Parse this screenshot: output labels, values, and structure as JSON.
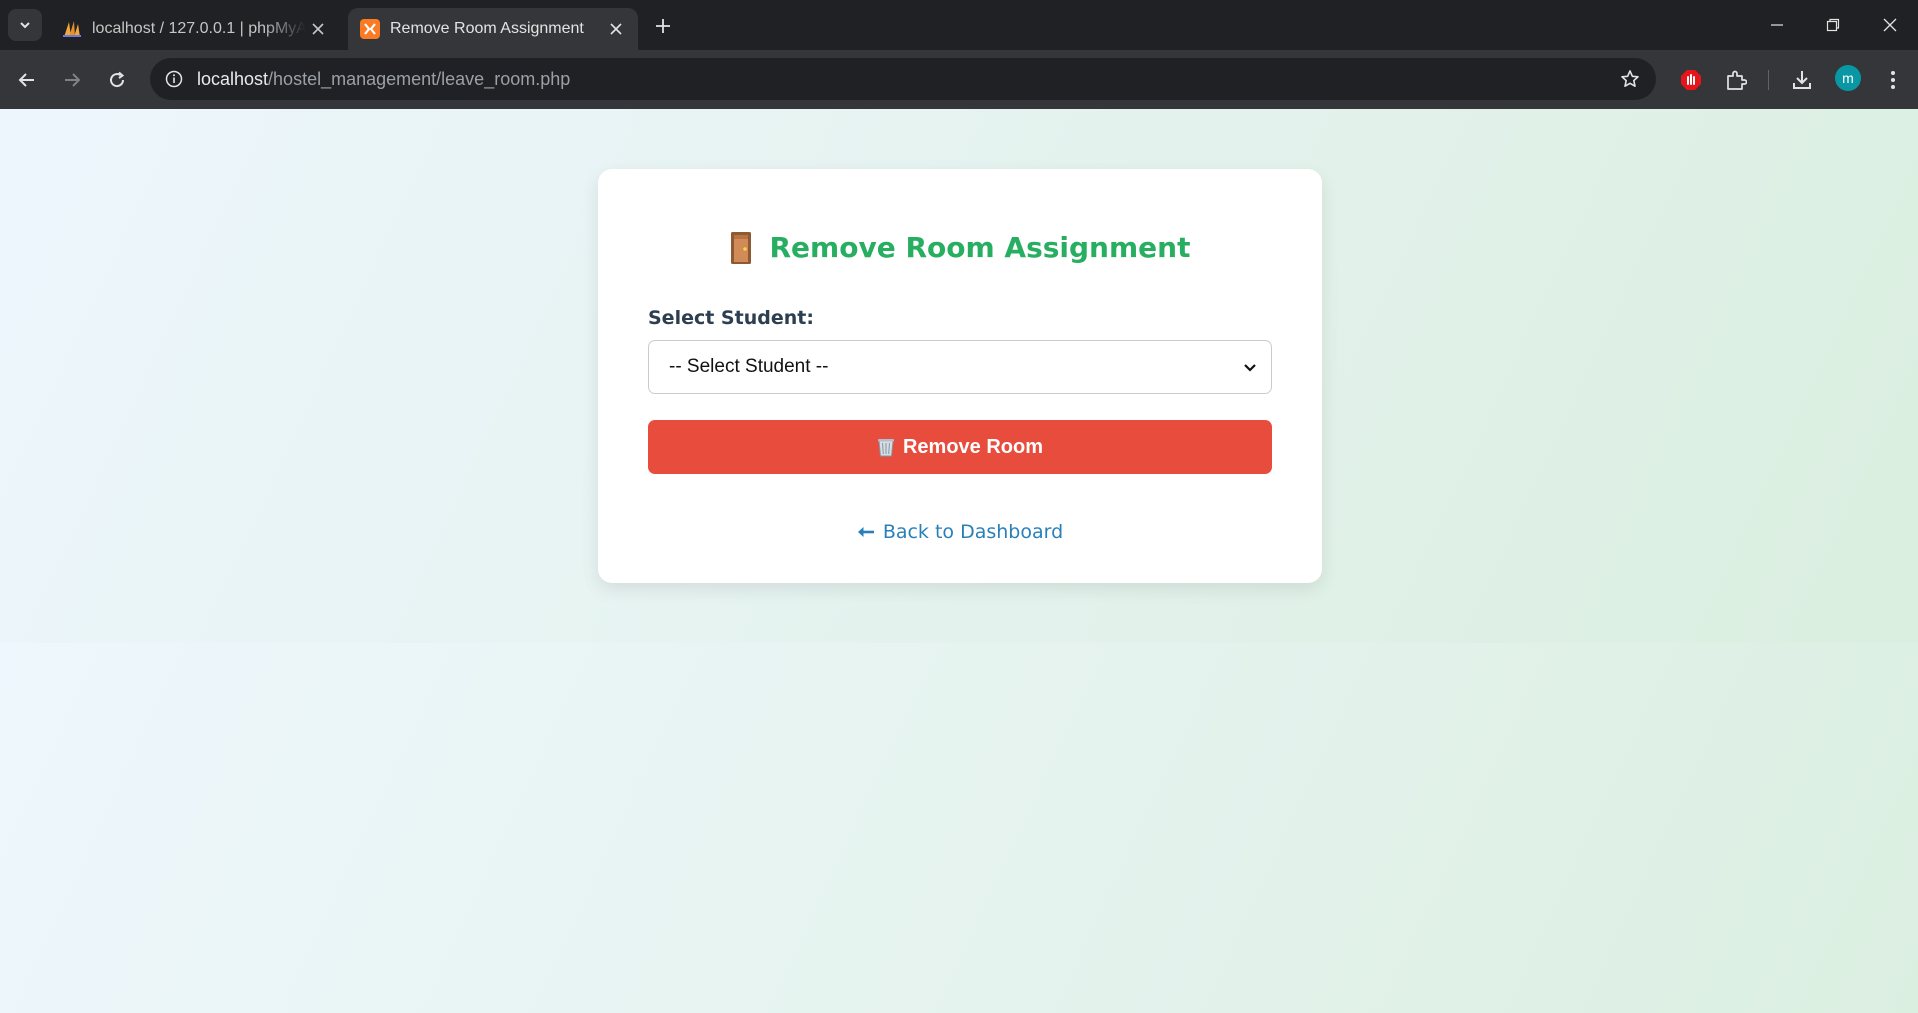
{
  "browser": {
    "tabs": [
      {
        "title": "localhost / 127.0.0.1 | phpMyAd",
        "icon": "phpmyadmin-icon",
        "active": false
      },
      {
        "title": "Remove Room Assignment",
        "icon": "xampp-icon",
        "active": true
      }
    ],
    "url": {
      "host": "localhost",
      "path": "/hostel_management/leave_room.php"
    },
    "profile_initial": "m"
  },
  "card": {
    "heading_icon": "door-icon",
    "heading": "Remove Room Assignment",
    "select_label": "Select Student:",
    "select_value": "-- Select Student --",
    "button_icon": "wastebasket-icon",
    "button_label": "Remove Room",
    "back_icon": "left-arrow-icon",
    "back_label": "Back to Dashboard"
  },
  "colors": {
    "heading": "#27ae60",
    "button": "#e74c3c",
    "link": "#2980b9",
    "label": "#2c3e50"
  }
}
